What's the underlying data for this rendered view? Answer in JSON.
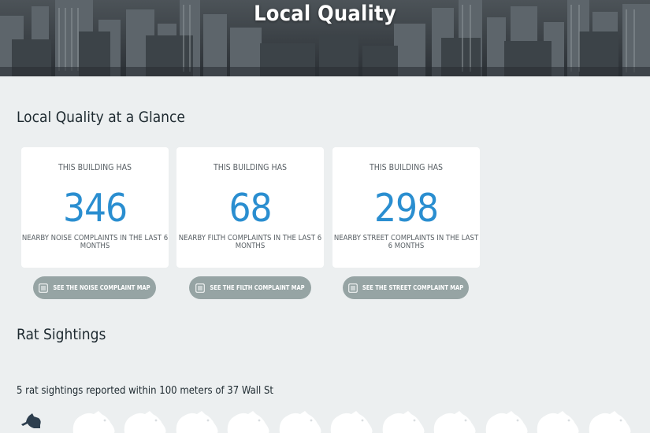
{
  "header": {
    "title": "Local Quality"
  },
  "glance": {
    "heading": "Local Quality at a Glance",
    "cards": [
      {
        "prefix": "THIS BUILDING HAS",
        "value": "346",
        "description": "NEARBY NOISE COMPLAINTS IN THE LAST 6 MONTHS",
        "button_label": "SEE THE NOISE COMPLAINT MAP"
      },
      {
        "prefix": "THIS BUILDING HAS",
        "value": "68",
        "description": "NEARBY FILTH COMPLAINTS IN THE LAST 6 MONTHS",
        "button_label": "SEE THE FILTH COMPLAINT MAP"
      },
      {
        "prefix": "THIS BUILDING HAS",
        "value": "298",
        "description": "NEARBY STREET COMPLAINTS IN THE LAST 6 MONTHS",
        "button_label": "SEE THE STREET COMPLAINT MAP"
      }
    ]
  },
  "rats": {
    "heading": "Rat Sightings",
    "summary": "5 rat sightings reported within 100 meters of 37 Wall St",
    "icon_name": "rat-icon",
    "total_icons": 12,
    "highlighted_icons": 1
  },
  "colors": {
    "accent": "#2a8ed0",
    "button": "#96a4a4",
    "background": "#eceff0",
    "rat_active": "#2d3e4e",
    "rat_inactive": "#ffffff"
  }
}
